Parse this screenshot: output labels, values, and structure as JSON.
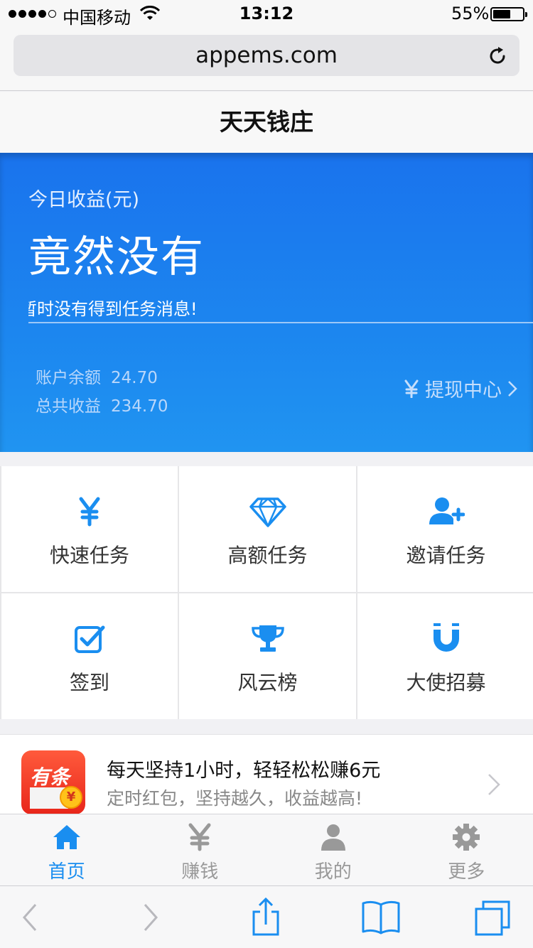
{
  "status_bar": {
    "carrier": "中国移动",
    "time": "13:12",
    "battery": "55%",
    "battery_level": 0.55,
    "signal_bars": 4
  },
  "browser": {
    "url": "appems.com"
  },
  "app": {
    "title": "天天钱庄"
  },
  "banner": {
    "income_label": "今日收益(元)",
    "income_value": "竟然没有",
    "marquee": "暂时没有得到任务消息!",
    "balance_label": "账户余额",
    "balance_value": "24.70",
    "total_label": "总共收益",
    "total_value": "234.70",
    "withdraw_label": "提现中心",
    "withdraw_icon": "yen-icon"
  },
  "grid": [
    {
      "label": "快速任务",
      "icon": "yen-icon"
    },
    {
      "label": "高额任务",
      "icon": "diamond-icon"
    },
    {
      "label": "邀请任务",
      "icon": "add-user-icon"
    },
    {
      "label": "签到",
      "icon": "checkbox-icon"
    },
    {
      "label": "风云榜",
      "icon": "trophy-icon"
    },
    {
      "label": "大使招募",
      "icon": "magnet-icon"
    }
  ],
  "promo": {
    "logo_text": "有条",
    "title": "每天坚持1小时，轻轻松松赚6元",
    "subtitle": "定时红包，坚持越久，收益越高!"
  },
  "tabs": [
    {
      "label": "首页",
      "icon": "home-icon",
      "active": true
    },
    {
      "label": "赚钱",
      "icon": "yen-icon",
      "active": false
    },
    {
      "label": "我的",
      "icon": "user-icon",
      "active": false
    },
    {
      "label": "更多",
      "icon": "gear-icon",
      "active": false
    }
  ],
  "colors": {
    "accent": "#1a8ef0",
    "banner_top": "#1a73ed",
    "banner_bottom": "#2094f1",
    "inactive": "#999999"
  }
}
